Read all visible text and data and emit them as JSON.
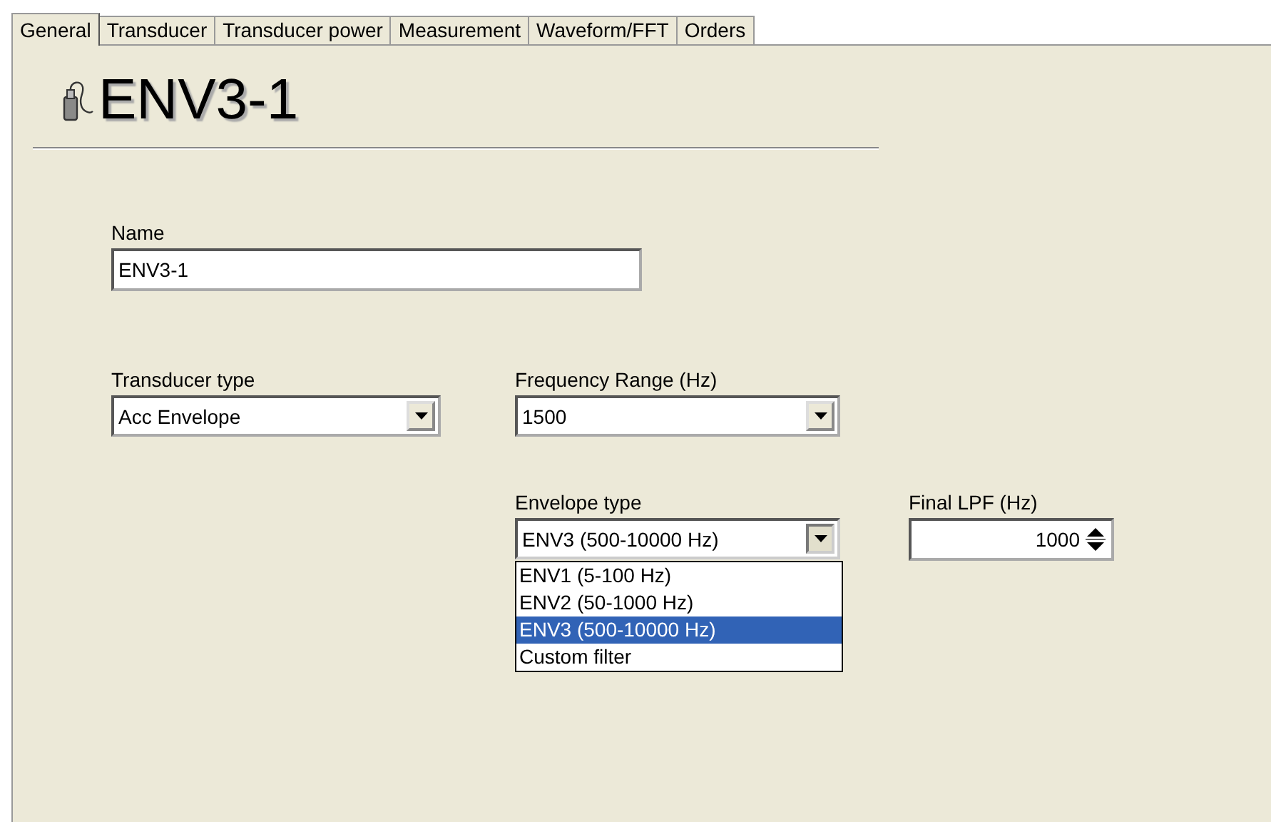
{
  "tabs": [
    {
      "label": "General",
      "selected": true
    },
    {
      "label": "Transducer",
      "selected": false
    },
    {
      "label": "Transducer power",
      "selected": false
    },
    {
      "label": "Measurement",
      "selected": false
    },
    {
      "label": "Waveform/FFT",
      "selected": false
    },
    {
      "label": "Orders",
      "selected": false
    }
  ],
  "heading": "ENV3-1",
  "name": {
    "label": "Name",
    "value": "ENV3-1"
  },
  "transducer_type": {
    "label": "Transducer type",
    "value": "Acc Envelope"
  },
  "frequency_range": {
    "label": "Frequency Range (Hz)",
    "value": "1500"
  },
  "envelope_type": {
    "label": "Envelope type",
    "value": "ENV3 (500-10000 Hz)",
    "expanded": true,
    "options": [
      {
        "label": "ENV1 (5-100 Hz)",
        "selected": false
      },
      {
        "label": "ENV2 (50-1000 Hz)",
        "selected": false
      },
      {
        "label": "ENV3 (500-10000 Hz)",
        "selected": true
      },
      {
        "label": "Custom filter",
        "selected": false
      }
    ]
  },
  "final_lpf": {
    "label": "Final LPF (Hz)",
    "value": "1000"
  }
}
